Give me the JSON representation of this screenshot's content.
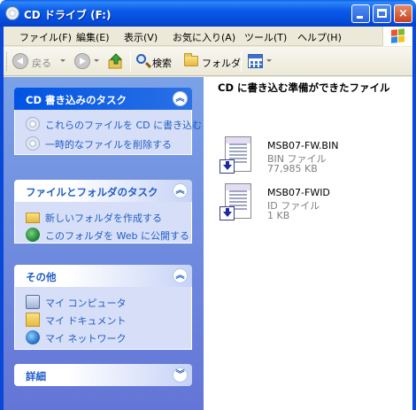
{
  "window": {
    "title": "CD ドライブ (F:)",
    "icon": "cd-drive-icon"
  },
  "titlebar_buttons": {
    "minimize": "minimize",
    "maximize": "maximize",
    "close": "×"
  },
  "menubar": {
    "items": [
      "ファイル(F)",
      "編集(E)",
      "表示(V)",
      "お気に入り(A)",
      "ツール(T)",
      "ヘルプ(H)"
    ]
  },
  "toolbar": {
    "back": "戻る",
    "search": "検索",
    "folders": "フォルダ"
  },
  "taskpane": {
    "groups": [
      {
        "title": "CD 書き込みのタスク",
        "chevron": "︽",
        "special": true,
        "tasks": [
          {
            "label": "これらのファイルを CD に書き込む",
            "icon": "cd-burn-icon"
          },
          {
            "label": "一時的なファイルを削除する",
            "icon": "delete-temp-icon"
          }
        ]
      },
      {
        "title": "ファイルとフォルダのタスク",
        "chevron": "︽",
        "tasks": [
          {
            "label": "新しいフォルダを作成する",
            "icon": "new-folder-icon"
          },
          {
            "label": "このフォルダを Web に公開する",
            "icon": "publish-web-icon"
          }
        ]
      },
      {
        "title": "その他",
        "chevron": "︽",
        "tasks": [
          {
            "label": "マイ コンピュータ",
            "icon": "my-computer-icon"
          },
          {
            "label": "マイ ドキュメント",
            "icon": "my-documents-icon"
          },
          {
            "label": "マイ ネットワーク",
            "icon": "my-network-icon"
          }
        ]
      },
      {
        "title": "詳細",
        "chevron": "︾"
      }
    ]
  },
  "main": {
    "heading": "CD に書き込む準備ができたファイル",
    "files": [
      {
        "name": "MSB07-FW.BIN",
        "type": "BIN ファイル",
        "size": "77,985 KB",
        "icon": "pending-burn-file-icon"
      },
      {
        "name": "MSB07-FWID",
        "type": "ID ファイル",
        "size": "1 KB",
        "icon": "pending-burn-file-icon"
      }
    ]
  },
  "colors": {
    "titlebar": "#0a5bea",
    "taskpane_bg": "#6f8fe0",
    "group_title": "#215dc6",
    "menubar_bg": "#ece9d8"
  }
}
